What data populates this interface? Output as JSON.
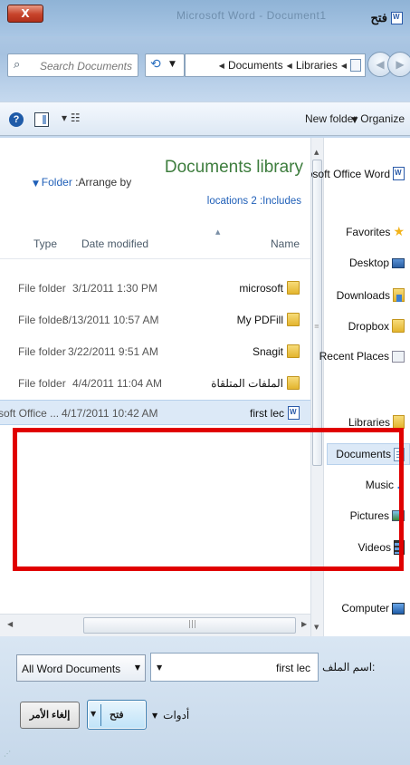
{
  "window": {
    "close_glyph": "X",
    "title_text": "Microsoft Word - Document1",
    "app_title": "فتح"
  },
  "address": {
    "search_placeholder": "Search Documents",
    "breadcrumbs": [
      "Documents",
      "Libraries"
    ]
  },
  "toolbar": {
    "help_glyph": "?",
    "new_folder": "New folder",
    "organize": "Organize"
  },
  "library": {
    "arrange_by_label": ":Arrange by",
    "arrange_by_value": "Folder",
    "title": "Documents library",
    "includes_label": ":Includes",
    "includes_value": "locations 2"
  },
  "columns": {
    "type": "Type",
    "date_modified": "Date modified",
    "name": "Name"
  },
  "files": [
    {
      "type": "File folder",
      "date": "3/1/2011 1:30 PM",
      "name": "microsoft",
      "icon": "folder-icon"
    },
    {
      "type": "File folder",
      "date": "3/13/2011 10:57 AM",
      "name": "My PDFill",
      "icon": "folder-icon"
    },
    {
      "type": "File folder",
      "date": "3/22/2011 9:51 AM",
      "name": "Snagit",
      "icon": "folder-icon"
    },
    {
      "type": "File folder",
      "date": "4/4/2011 11:04 AM",
      "name": "الملفات المتلقاة",
      "icon": "folder-icon"
    },
    {
      "type": "soft Office ...",
      "date": "4/17/2011 10:42 AM",
      "name": "first lec",
      "icon": "word-doc-icon",
      "selected": true
    }
  ],
  "nav": {
    "recent_doc": "rosoft Office Word",
    "favorites": "Favorites",
    "desktop": "Desktop",
    "downloads": "Downloads",
    "dropbox": "Dropbox",
    "recent_places": "Recent Places",
    "libraries": "Libraries",
    "documents": "Documents",
    "music": "Music",
    "pictures": "Pictures",
    "videos": "Videos",
    "computer": "Computer"
  },
  "bottom": {
    "file_type": "All Word Documents",
    "file_name": "first lec",
    "file_name_label": "اسم الملف:",
    "tools": "أدوات",
    "open": "فتح",
    "cancel": "إلغاء الأمر"
  },
  "colors": {
    "highlight_box": "#e00000",
    "library_title": "#3d7d3d",
    "link": "#1f5fb8",
    "selection": "#dce9f7"
  }
}
